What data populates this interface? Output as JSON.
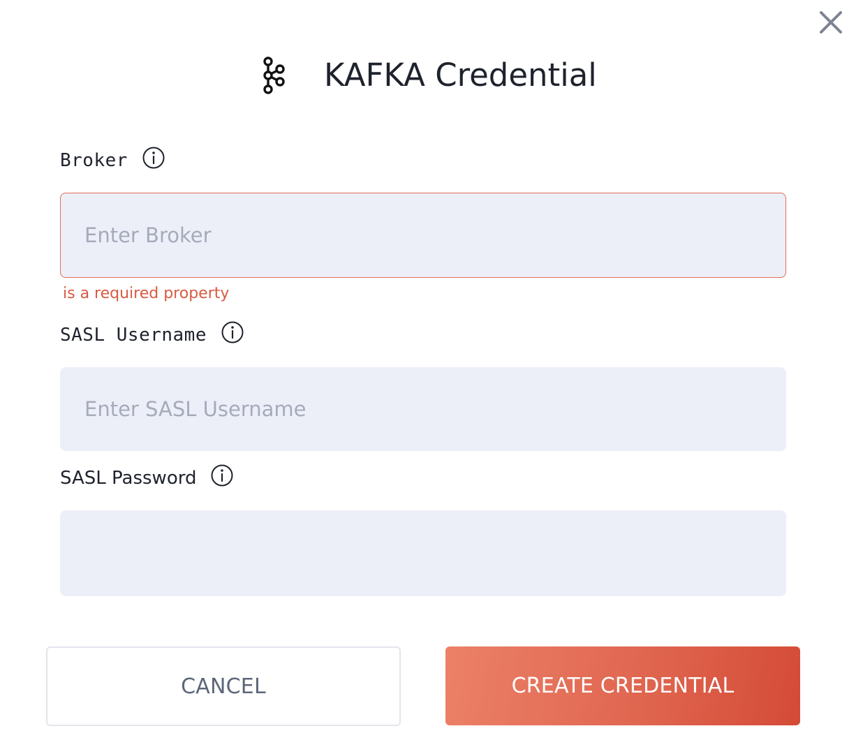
{
  "dialog": {
    "title": "KAFKA Credential",
    "icons": {
      "close": "close-icon",
      "logo": "kafka-logo-icon",
      "info": "info-icon"
    }
  },
  "fields": {
    "broker": {
      "label": "Broker",
      "placeholder": "Enter Broker",
      "value": "",
      "error": "is a required property"
    },
    "sasl_username": {
      "label": "SASL Username",
      "placeholder": "Enter SASL Username",
      "value": ""
    },
    "sasl_password": {
      "label": "SASL Password",
      "placeholder": "",
      "value": ""
    }
  },
  "actions": {
    "cancel_label": "CANCEL",
    "create_label": "CREATE CREDENTIAL"
  },
  "colors": {
    "accent": "#e06650",
    "error": "#d95a42",
    "input_bg": "#edeff8",
    "placeholder": "#a5abbb",
    "text": "#1e222c"
  }
}
